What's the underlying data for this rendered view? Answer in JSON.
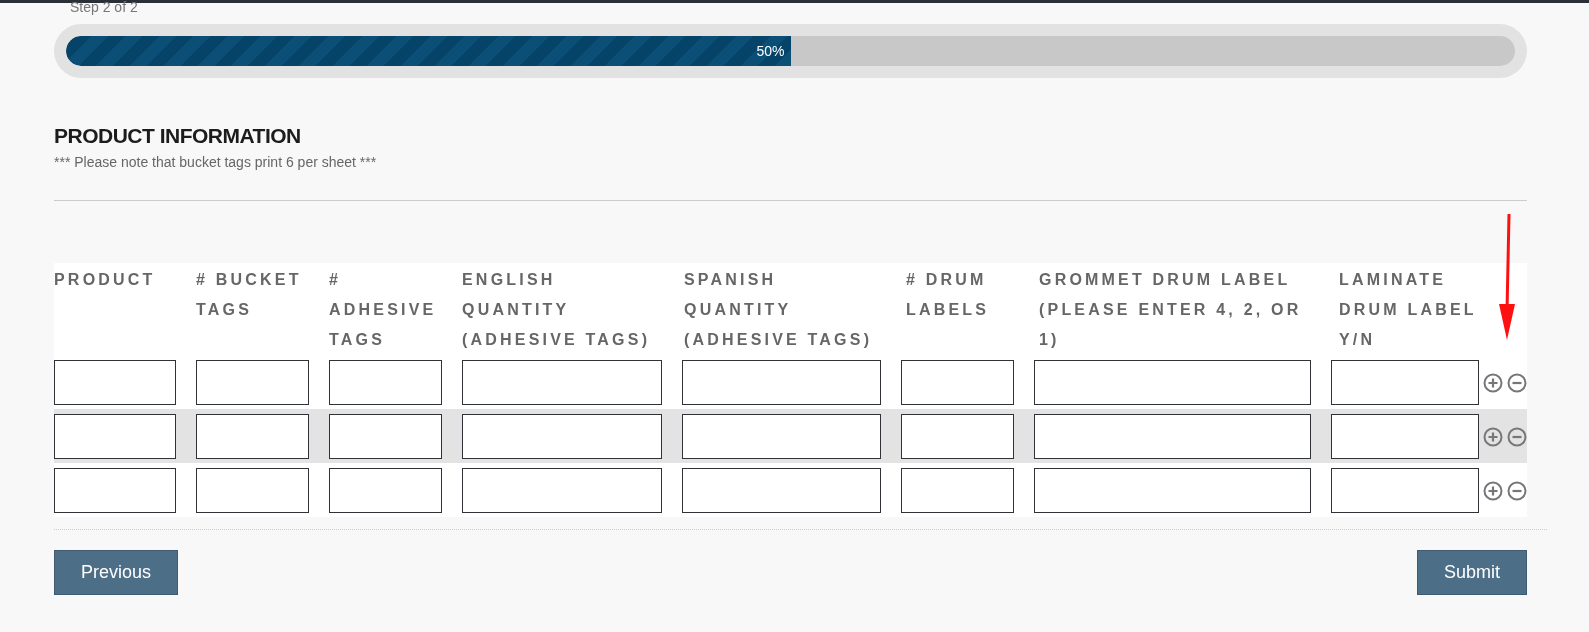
{
  "step_label": "Step 2 of 2",
  "progress": {
    "level": 0.5,
    "reading": "50%"
  },
  "section": {
    "title": "PRODUCT INFORMATION",
    "note": "*** Please note that bucket tags print 6 per sheet ***"
  },
  "table": {
    "columns": [
      "PRODUCT",
      "# BUCKET TAGS",
      "# ADHESIVE TAGS",
      "ENGLISH QUANTITY (ADHESIVE TAGS)",
      "SPANISH QUANTITY (ADHESIVE TAGS)",
      "# DRUM LABELS",
      "GROMMET DRUM LABEL (PLEASE ENTER 4, 2, OR 1)",
      "LAMINATE DRUM LABEL Y/N"
    ],
    "rows": [
      {
        "shaded": false
      },
      {
        "shaded": true
      },
      {
        "shaded": false
      }
    ]
  },
  "buttons": {
    "previous": "Previous",
    "submit": "Submit"
  }
}
